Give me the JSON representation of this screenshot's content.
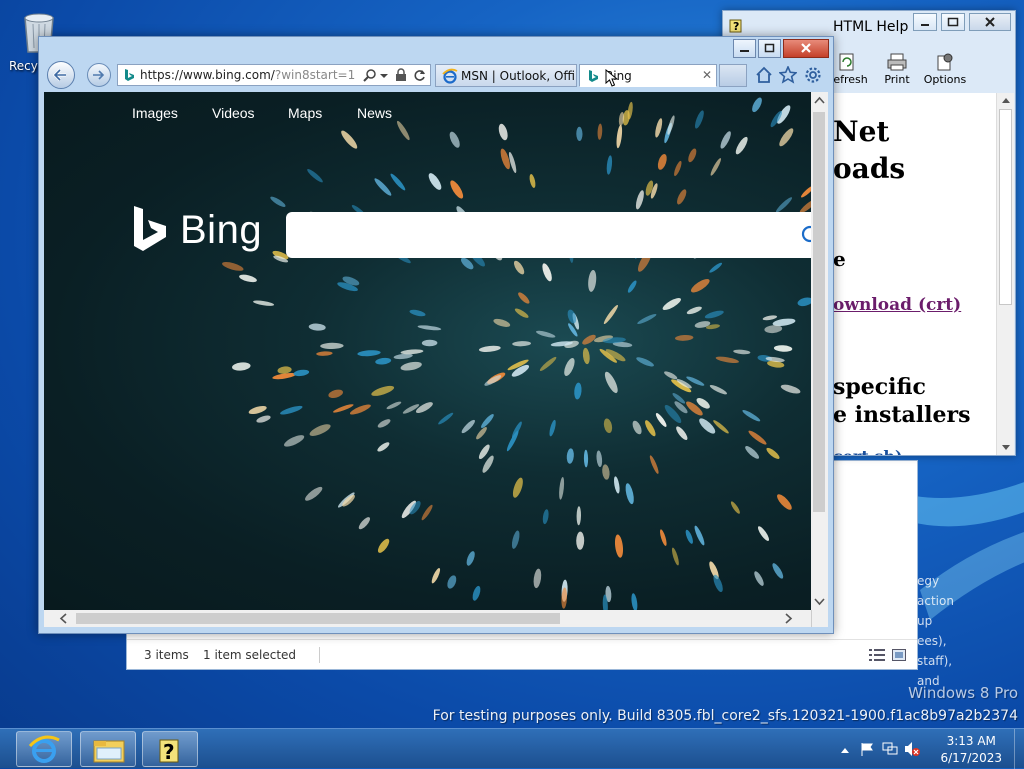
{
  "desktop": {
    "recycle_bin_label": "Recyc",
    "watermark_title": "Windows 8 Pro",
    "watermark_build": "For testing purposes only. Build 8305.fbl_core2_sfs.120321-1900.f1ac8b97a2b2374"
  },
  "explorer": {
    "items_count": "3 items",
    "selected": "1 item selected",
    "underlying_text": [
      "egy action up",
      "ees),",
      "staff), and"
    ]
  },
  "help_window": {
    "title": "HTML Help",
    "toolbar": [
      "Refresh",
      "Print",
      "Options"
    ],
    "content": {
      "h1_line1": "Net",
      "h1_line2": "oads",
      "h2": "e",
      "link_download": "ownload (crt)",
      "h3_line1": "specific",
      "h3_line2": "e installers",
      "link_script": "cert.sh)"
    }
  },
  "ie": {
    "address": "https://www.bing.com/",
    "address_dim": "?win8start=1",
    "tabs": [
      {
        "label": "MSN | Outlook, Offi...",
        "active": false
      },
      {
        "label": "Bing",
        "active": true
      }
    ],
    "page": {
      "menu": [
        "Images",
        "Videos",
        "Maps",
        "News"
      ],
      "brand": "Bing",
      "search_placeholder": ""
    }
  },
  "taskbar": {
    "apps": [
      "internet-explorer",
      "file-explorer",
      "html-help"
    ],
    "time": "3:13 AM",
    "date": "6/17/2023"
  },
  "colors": {
    "desktop_blue": "#1664c4",
    "bing_bg": "#0f2d33",
    "help_link": "#6b1d6b",
    "help_link2": "#1a4f9c"
  }
}
